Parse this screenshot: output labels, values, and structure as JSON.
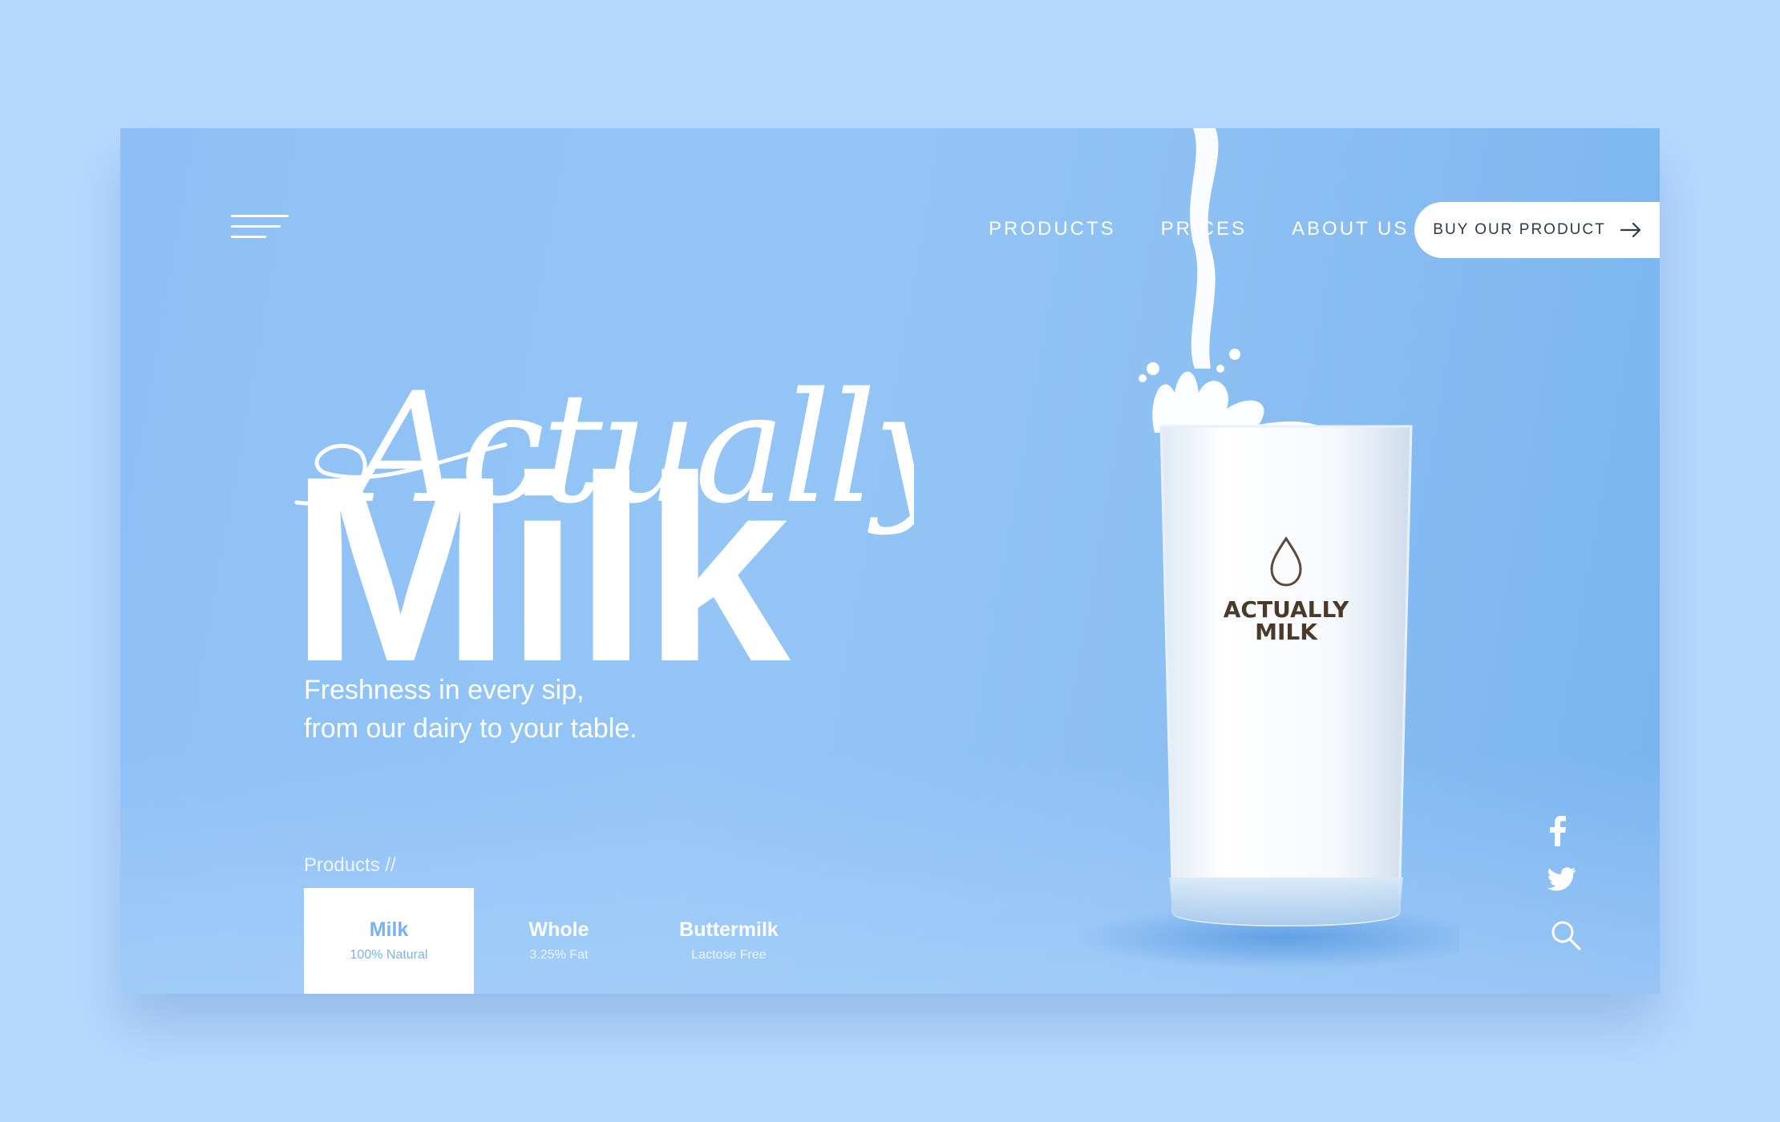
{
  "nav": {
    "items": [
      "PRODUCTS",
      "PRICES",
      "ABOUT US"
    ],
    "cta": "BUY OUR PRODUCT"
  },
  "hero": {
    "script_word": "Actually",
    "title": "Milk",
    "tagline_line1": "Freshness in every sip,",
    "tagline_line2": "from our dairy to your table."
  },
  "products": {
    "label": "Products //",
    "tabs": [
      {
        "name": "Milk",
        "sub": "100% Natural"
      },
      {
        "name": "Whole",
        "sub": "3.25% Fat"
      },
      {
        "name": "Buttermilk",
        "sub": "Lactose Free"
      }
    ]
  },
  "glass_label": {
    "line1": "ACTUALLY",
    "line2": "MILK"
  },
  "social": {
    "icons": [
      "facebook-icon",
      "twitter-icon",
      "search-icon"
    ]
  },
  "colors": {
    "page_bg": "#b7d9ff",
    "hero_blue": "#8ec0f5",
    "accent": "#79b2ef",
    "label_brown": "#4a3a2a"
  }
}
